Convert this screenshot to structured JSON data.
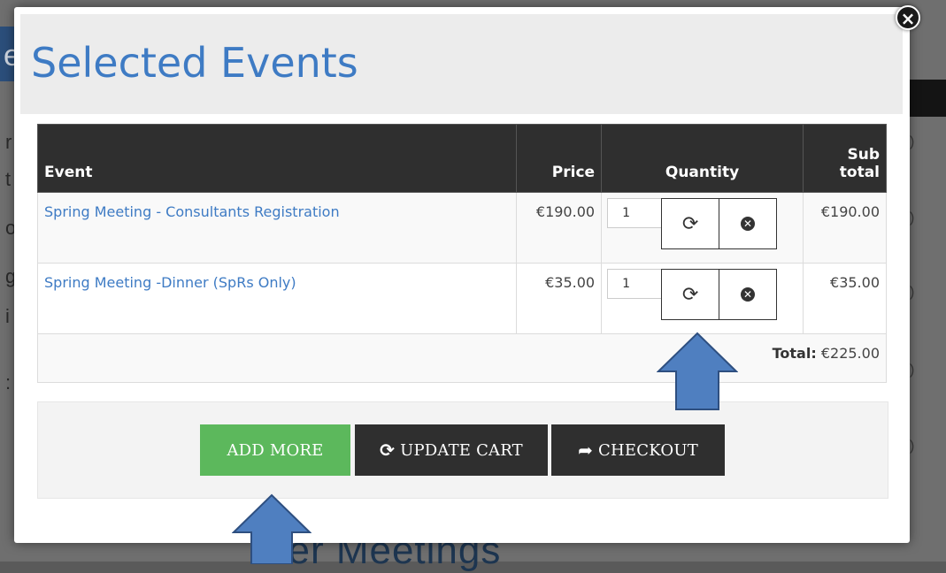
{
  "modal": {
    "title": "Selected Events",
    "close_icon": "close-icon"
  },
  "table": {
    "headers": {
      "event": "Event",
      "price": "Price",
      "quantity": "Quantity",
      "subtotal_line1": "Sub",
      "subtotal_line2": "total"
    },
    "rows": [
      {
        "event": "Spring Meeting - Consultants Registration",
        "price": "€190.00",
        "quantity": "1",
        "subtotal": "€190.00"
      },
      {
        "event": "Spring Meeting -Dinner (SpRs Only)",
        "price": "€35.00",
        "quantity": "1",
        "subtotal": "€35.00"
      }
    ],
    "total_label": "Total:",
    "total_value": "€225.00"
  },
  "buttons": {
    "add_more": "ADD MORE",
    "update_cart": "UPDATE CART",
    "checkout": "CHECKOUT"
  },
  "background": {
    "partial_heading": "ner Meetings"
  },
  "colors": {
    "title_blue": "#3e7bc4",
    "add_more_green": "#5cb85c",
    "dark_button": "#2f2f2f",
    "arrow_blue": "#4f7fc0"
  }
}
